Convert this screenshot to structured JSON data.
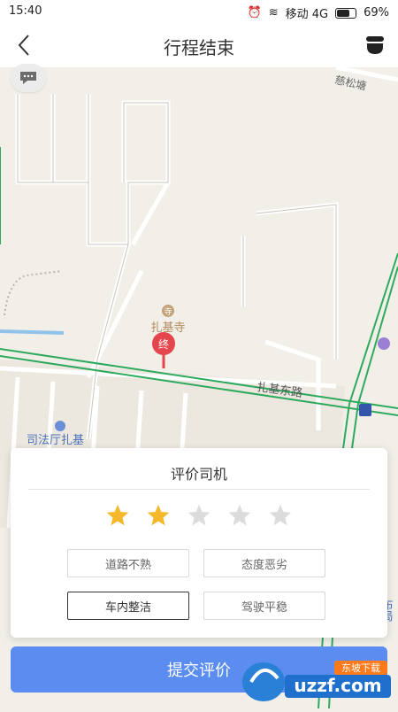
{
  "status_bar": {
    "time": "15:40",
    "carrier": "移动 4G",
    "battery": "69%"
  },
  "nav": {
    "title": "行程结束",
    "back_icon": "back-icon",
    "right_icon": "menu-icon"
  },
  "map": {
    "labels": {
      "temple": "扎基寺",
      "road": "扎基东路",
      "neighborhood": "司法厅扎基",
      "corner_label": "慈松塘",
      "edge_text": "布局",
      "end_marker": "终"
    }
  },
  "rating_card": {
    "title": "评价司机",
    "rating": 2,
    "max_rating": 5,
    "tags": [
      {
        "label": "道路不熟",
        "selected": false
      },
      {
        "label": "态度恶劣",
        "selected": false
      },
      {
        "label": "车内整洁",
        "selected": true
      },
      {
        "label": "驾驶平稳",
        "selected": false
      }
    ]
  },
  "submit_label": "提交评价",
  "watermark": {
    "domain": "uzzf.com",
    "site": "东坡下载"
  },
  "colors": {
    "accent": "#5b8df0",
    "star_active": "#f5b82a",
    "star_inactive": "#dcdcdc",
    "route": "#2eaa5e",
    "marker": "#e5454d"
  }
}
